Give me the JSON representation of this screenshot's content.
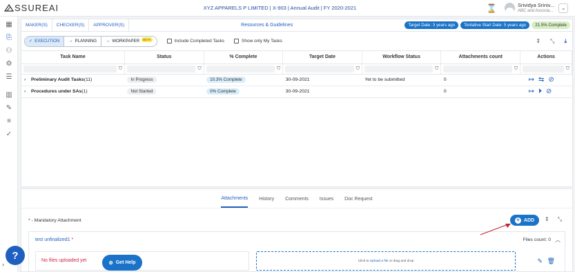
{
  "header": {
    "logo_text": "SSUREAI",
    "title": "XYZ APPARELS P LIMITED | X-903 | Annual Audit | FY 2020-2021",
    "user_name": "Srividya Sriniv...",
    "user_org": "ABC and Associa..."
  },
  "tabs": {
    "maker": "MAKER(S)",
    "checker": "CHECKER(S)",
    "approver": "APPROVER(S)",
    "resources": "Resources & Guidelines",
    "target_date": "Target Date: 3 years ago",
    "start_date": "Tentative Start Date: 5 years ago",
    "complete": "21.5% Complete"
  },
  "filters": {
    "execution": "EXECUTION",
    "planning": "PLANNING",
    "workpaper": "WORKPAPER",
    "beta": "BETA",
    "include_completed": "Include Completed Tasks",
    "only_mine": "Show only My Tasks"
  },
  "table": {
    "columns": [
      "Task Name",
      "Status",
      "% Complete",
      "Target Date",
      "Workflow Status",
      "Attachments count",
      "Actions"
    ],
    "rows": [
      {
        "name": "Preliminary Audit Tasks",
        "count": "(11)",
        "status": "In Progress",
        "complete": "10.3% Complete",
        "target": "30-09-2021",
        "workflow": "Yet to be submitted",
        "attachments": "0"
      },
      {
        "name": "Procedures under SAs",
        "count": "(1)",
        "status": "Not Started",
        "complete": "0% Complete",
        "target": "30-09-2021",
        "workflow": "",
        "attachments": "0"
      }
    ]
  },
  "lower": {
    "tabs": [
      "Attachments",
      "History",
      "Comments",
      "Issues",
      "Doc Request"
    ],
    "mandatory": "* - Mandatory Attachment",
    "add": "ADD",
    "card_title": "test unfinalized1",
    "card_required": "*",
    "files_count": "Files count: 0",
    "no_files": "No files uploaded yet",
    "drop_prefix": "Click to",
    "drop_link": "Upload a file",
    "drop_suffix": "or drag and drop"
  },
  "help": {
    "question": "?",
    "get_help": "Get Help"
  },
  "colors": {
    "primary": "#1a73c8",
    "accent": "#1f5fbf",
    "success_pill": "#d7efc5",
    "warning": "#d0244a"
  }
}
